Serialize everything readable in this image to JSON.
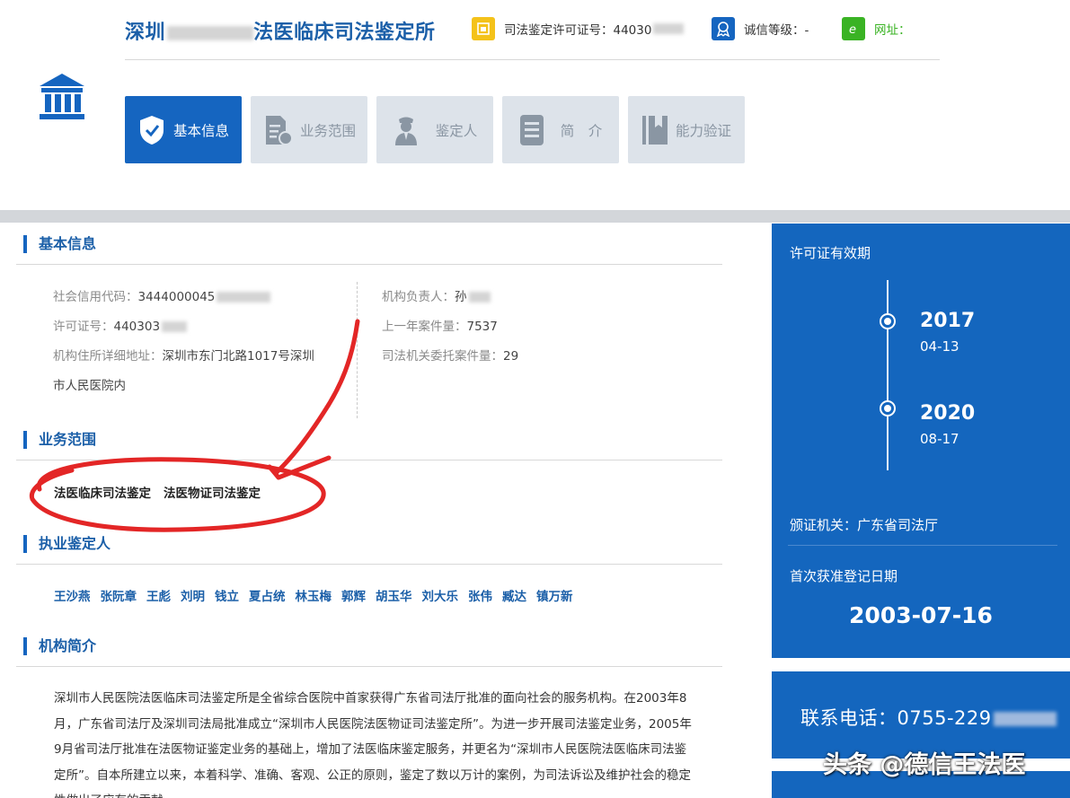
{
  "header": {
    "title_prefix": "深圳",
    "title_suffix": "法医临床司法鉴定所",
    "license_label": "司法鉴定许可证号：44030",
    "credit_label": "诚信等级：-",
    "website_label": "网址："
  },
  "tabs": [
    {
      "label": "基本信息",
      "icon": "shield-check-icon"
    },
    {
      "label": "业务范围",
      "icon": "document-icon"
    },
    {
      "label": "鉴定人",
      "icon": "person-icon"
    },
    {
      "label": "简　介",
      "icon": "list-icon"
    },
    {
      "label": "能力验证",
      "icon": "bookmark-icon"
    }
  ],
  "sections": {
    "basic": "基本信息",
    "scope": "业务范围",
    "experts": "执业鉴定人",
    "intro": "机构简介"
  },
  "basic_info": {
    "credit_code_label": "社会信用代码：",
    "credit_code_value": "3444000045",
    "license_label": "许可证号：",
    "license_value": "440303",
    "address_label": "机构住所详细地址：",
    "address_value_line1": "深圳市东门北路1017号深圳",
    "address_value_line2": "市人民医院内",
    "head_label": "机构负责人：",
    "head_value": "孙",
    "last_year_label": "上一年案件量：",
    "last_year_value": "7537",
    "judicial_label": "司法机关委托案件量：",
    "judicial_value": "29"
  },
  "scope_items": [
    "法医临床司法鉴定",
    "法医物证司法鉴定"
  ],
  "experts": [
    "王沙燕",
    "张阮章",
    "王彪",
    "刘明",
    "钱立",
    "夏占统",
    "林玉梅",
    "郭辉",
    "胡玉华",
    "刘大乐",
    "张伟",
    "臧达",
    "镇万新"
  ],
  "intro_text": "深圳市人民医院法医临床司法鉴定所是全省综合医院中首家获得广东省司法厅批准的面向社会的服务机构。在2003年8月，广东省司法厅及深圳司法局批准成立“深圳市人民医院法医物证司法鉴定所”。为进一步开展司法鉴定业务，2005年9月省司法厅批准在法医物证鉴定业务的基础上，增加了法医临床鉴定服务，并更名为“深圳市人民医院法医临床司法鉴定所”。自本所建立以来，本着科学、准确、客观、公正的原则，鉴定了数以万计的案例，为司法诉讼及维护社会的稳定性做出了应有的贡献。",
  "license_panel": {
    "validity_label": "许可证有效期",
    "start_year": "2017",
    "start_md": "04-13",
    "end_year": "2020",
    "end_md": "08-17",
    "issuer_label": "颁证机关：广东省司法厅",
    "first_reg_label": "首次获准登记日期",
    "first_reg_date": "2003-07-16"
  },
  "contact": {
    "phone_label": "联系电话：0755-229"
  },
  "watermark": "头条 @德信王法医",
  "colors": {
    "brand_blue": "#1565c0",
    "panel_blue": "#1466be",
    "annotation_red": "#e32626"
  }
}
